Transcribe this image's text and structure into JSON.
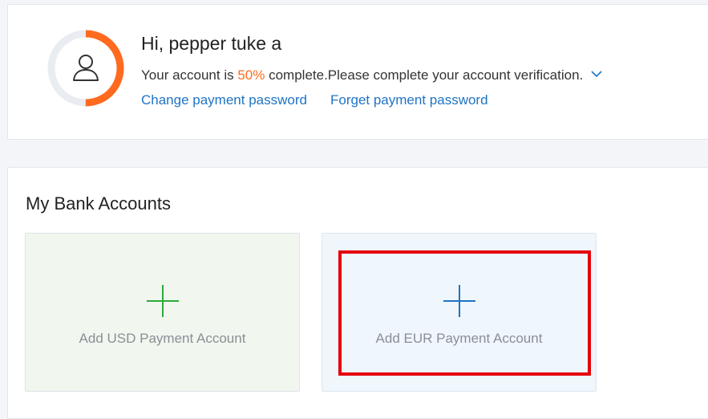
{
  "profile": {
    "greeting": "Hi, pepper tuke a",
    "status_prefix": "Your account is ",
    "completion_percent": "50%",
    "completion_value": 0.5,
    "status_suffix": " complete.Please complete your account verification.",
    "links": {
      "change_password": "Change payment password",
      "forget_password": "Forget payment password"
    },
    "icons": {
      "avatar": "user-icon",
      "expand": "chevron-down-icon"
    },
    "colors": {
      "progress": "#ff6a1f",
      "progress_track": "#e9edf2",
      "link": "#1f74c4"
    }
  },
  "bank_accounts": {
    "title": "My Bank Accounts",
    "tiles": [
      {
        "label": "Add USD Payment Account",
        "icon": "plus-icon",
        "icon_color": "#2daa3a"
      },
      {
        "label": "Add EUR Payment Account",
        "icon": "plus-icon",
        "icon_color": "#1f74c4"
      }
    ],
    "highlight_color": "#e5000b"
  }
}
